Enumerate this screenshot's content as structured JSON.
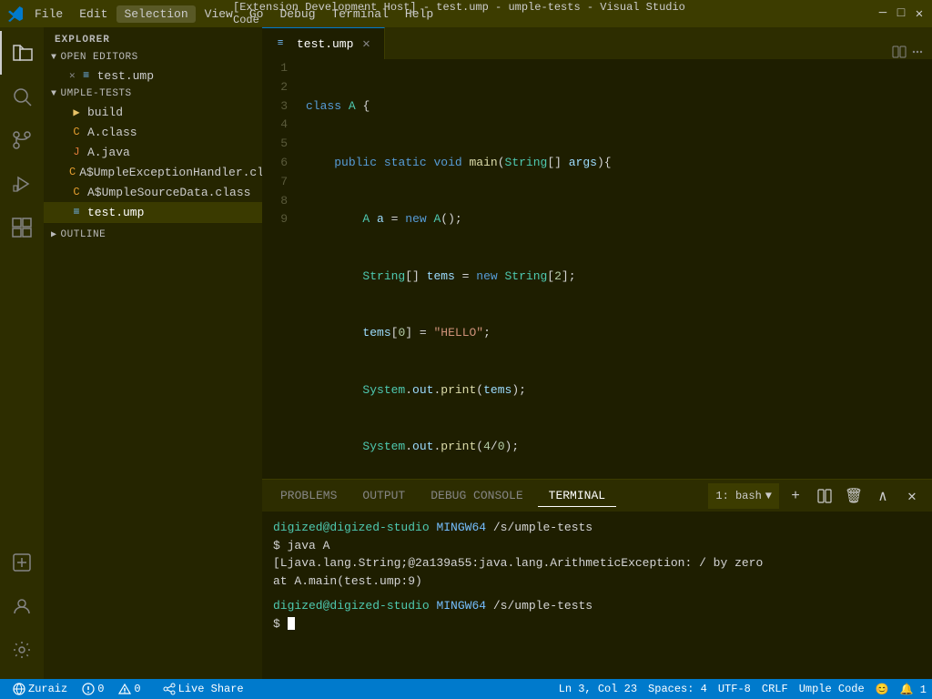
{
  "titlebar": {
    "logo": "❖",
    "menu": [
      "File",
      "Edit",
      "Selection",
      "View",
      "Go",
      "Debug",
      "Terminal",
      "Help"
    ],
    "active_menu": "Selection",
    "title": "[Extension Development Host] - test.ump - umple-tests - Visual Studio Code",
    "controls": [
      "─",
      "□",
      "✕"
    ]
  },
  "activity_bar": {
    "icons": [
      {
        "name": "explorer-icon",
        "symbol": "⎗",
        "active": true
      },
      {
        "name": "search-icon",
        "symbol": "🔍"
      },
      {
        "name": "source-control-icon",
        "symbol": "⎇"
      },
      {
        "name": "run-debug-icon",
        "symbol": "▷"
      },
      {
        "name": "extensions-icon",
        "symbol": "⊞"
      }
    ],
    "bottom_icons": [
      {
        "name": "remote-icon",
        "symbol": "⧉"
      },
      {
        "name": "accounts-icon",
        "symbol": "👤"
      },
      {
        "name": "settings-icon",
        "symbol": "⚙"
      }
    ]
  },
  "sidebar": {
    "header": "Explorer",
    "open_editors": {
      "label": "Open Editors",
      "files": [
        {
          "name": "test.ump",
          "icon": "ump",
          "close": true
        }
      ]
    },
    "project": {
      "label": "Umple-Tests",
      "items": [
        {
          "name": "build",
          "type": "folder",
          "indent": 1
        },
        {
          "name": "A.class",
          "type": "class",
          "indent": 1
        },
        {
          "name": "A.java",
          "type": "java",
          "indent": 1
        },
        {
          "name": "A$UmpleExceptionHandler.class",
          "type": "class",
          "indent": 1
        },
        {
          "name": "A$UmpleSourceData.class",
          "type": "class",
          "indent": 1
        },
        {
          "name": "test.ump",
          "type": "ump",
          "indent": 1,
          "active": true
        }
      ]
    },
    "outline": {
      "label": "Outline"
    }
  },
  "editor": {
    "tab": {
      "name": "test.ump",
      "icon": "ump",
      "modified": false
    },
    "lines": [
      {
        "num": 1,
        "tokens": [
          {
            "t": "kw",
            "v": "class"
          },
          {
            "t": "plain",
            "v": " "
          },
          {
            "t": "cls",
            "v": "A"
          },
          {
            "t": "plain",
            "v": " {"
          }
        ]
      },
      {
        "num": 2,
        "tokens": [
          {
            "t": "plain",
            "v": "    "
          },
          {
            "t": "kw",
            "v": "public"
          },
          {
            "t": "plain",
            "v": " "
          },
          {
            "t": "kw",
            "v": "static"
          },
          {
            "t": "plain",
            "v": " "
          },
          {
            "t": "kw",
            "v": "void"
          },
          {
            "t": "plain",
            "v": " "
          },
          {
            "t": "fn",
            "v": "main"
          },
          {
            "t": "plain",
            "v": "("
          },
          {
            "t": "type",
            "v": "String"
          },
          {
            "t": "plain",
            "v": "[] "
          },
          {
            "t": "var",
            "v": "args"
          },
          {
            "t": "plain",
            "v": "){"
          }
        ]
      },
      {
        "num": 3,
        "tokens": [
          {
            "t": "plain",
            "v": "        "
          },
          {
            "t": "cls",
            "v": "A"
          },
          {
            "t": "plain",
            "v": " "
          },
          {
            "t": "var",
            "v": "a"
          },
          {
            "t": "plain",
            "v": " = "
          },
          {
            "t": "kw",
            "v": "new"
          },
          {
            "t": "plain",
            "v": " "
          },
          {
            "t": "cls",
            "v": "A"
          },
          {
            "t": "plain",
            "v": "();"
          }
        ]
      },
      {
        "num": 4,
        "tokens": [
          {
            "t": "plain",
            "v": "        "
          },
          {
            "t": "type",
            "v": "String"
          },
          {
            "t": "plain",
            "v": "[] "
          },
          {
            "t": "var",
            "v": "tems"
          },
          {
            "t": "plain",
            "v": " = "
          },
          {
            "t": "kw",
            "v": "new"
          },
          {
            "t": "plain",
            "v": " "
          },
          {
            "t": "type",
            "v": "String"
          },
          {
            "t": "plain",
            "v": "["
          },
          {
            "t": "num",
            "v": "2"
          },
          {
            "t": "plain",
            "v": "];"
          }
        ]
      },
      {
        "num": 5,
        "tokens": [
          {
            "t": "plain",
            "v": "        "
          },
          {
            "t": "var",
            "v": "tems"
          },
          {
            "t": "plain",
            "v": "["
          },
          {
            "t": "num",
            "v": "0"
          },
          {
            "t": "plain",
            "v": "] = "
          },
          {
            "t": "str",
            "v": "\"HELLO\""
          },
          {
            "t": "plain",
            "v": ";"
          }
        ]
      },
      {
        "num": 6,
        "tokens": [
          {
            "t": "plain",
            "v": "        "
          },
          {
            "t": "type",
            "v": "System"
          },
          {
            "t": "plain",
            "v": "."
          },
          {
            "t": "var",
            "v": "out"
          },
          {
            "t": "plain",
            "v": "."
          },
          {
            "t": "fn",
            "v": "print"
          },
          {
            "t": "plain",
            "v": "("
          },
          {
            "t": "var",
            "v": "tems"
          },
          {
            "t": "plain",
            "v": ");"
          }
        ]
      },
      {
        "num": 7,
        "tokens": [
          {
            "t": "plain",
            "v": "        "
          },
          {
            "t": "type",
            "v": "System"
          },
          {
            "t": "plain",
            "v": "."
          },
          {
            "t": "var",
            "v": "out"
          },
          {
            "t": "plain",
            "v": "."
          },
          {
            "t": "fn",
            "v": "print"
          },
          {
            "t": "plain",
            "v": "("
          },
          {
            "t": "num",
            "v": "4"
          },
          {
            "t": "plain",
            "v": "/"
          },
          {
            "t": "num",
            "v": "0"
          },
          {
            "t": "plain",
            "v": ");"
          }
        ]
      },
      {
        "num": 8,
        "tokens": [
          {
            "t": "plain",
            "v": "    }"
          }
        ]
      },
      {
        "num": 9,
        "tokens": [
          {
            "t": "plain",
            "v": "}"
          }
        ]
      }
    ]
  },
  "panel": {
    "tabs": [
      "PROBLEMS",
      "OUTPUT",
      "DEBUG CONSOLE",
      "TERMINAL"
    ],
    "active_tab": "TERMINAL",
    "terminal": {
      "shell_label": "1: bash",
      "lines": [
        {
          "type": "prompt",
          "user": "digized@digized-studio",
          "dir_label": "MINGW64",
          "path": "/s/umple-tests"
        },
        {
          "type": "cmd",
          "text": "$ java A"
        },
        {
          "type": "output",
          "text": "[Ljava.lang.String;@2a139a55:java.lang.ArithmeticException: / by zero"
        },
        {
          "type": "output",
          "text": "        at A.main(test.ump:9)"
        },
        {
          "type": "blank"
        },
        {
          "type": "prompt",
          "user": "digized@digized-studio",
          "dir_label": "MINGW64",
          "path": "/s/umple-tests"
        },
        {
          "type": "cmd_cursor",
          "text": "$ "
        }
      ]
    }
  },
  "statusbar": {
    "left": [
      {
        "icon": "⓪",
        "text": "0",
        "type": "error"
      },
      {
        "icon": "△",
        "text": "0",
        "type": "warning"
      }
    ],
    "remote": "Zuraiz",
    "live_share": "Live Share",
    "right": [
      {
        "text": "Ln 3, Col 23"
      },
      {
        "text": "Spaces: 4"
      },
      {
        "text": "UTF-8"
      },
      {
        "text": "CRLF"
      },
      {
        "text": "Umple Code"
      },
      {
        "text": "😊"
      },
      {
        "text": "🔔 1"
      }
    ]
  }
}
